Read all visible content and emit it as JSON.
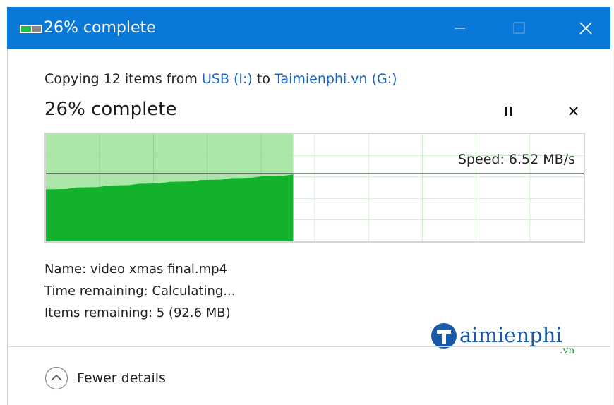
{
  "window": {
    "title": "26% complete",
    "title_color": "#0a78d7"
  },
  "copy": {
    "prefix": "Copying 12 items from ",
    "source": "USB (I:)",
    "middle": " to ",
    "destination": "Taimienphi.vn (G:)"
  },
  "progress": {
    "label": "26% complete",
    "fraction": 0.46,
    "fill_color": "#12b22c",
    "shade_color": "#9de39b"
  },
  "speed": {
    "label": "Speed: 6.52 MB/s"
  },
  "details": {
    "name": "Name: video xmas final.mp4",
    "time_remaining": "Time remaining: Calculating...",
    "items_remaining": "Items remaining: 5 (92.6 MB)"
  },
  "watermark": {
    "brand": "aimienphi",
    "suffix": ".vn"
  },
  "footer": {
    "fewer_details": "Fewer details"
  },
  "icons": {
    "title_icon": "copy-progress-icon",
    "minimize": "minimize-icon",
    "maximize": "maximize-icon",
    "close": "close-icon",
    "pause": "pause-icon",
    "cancel": "cancel-icon",
    "fewer": "chevron-up-icon"
  }
}
